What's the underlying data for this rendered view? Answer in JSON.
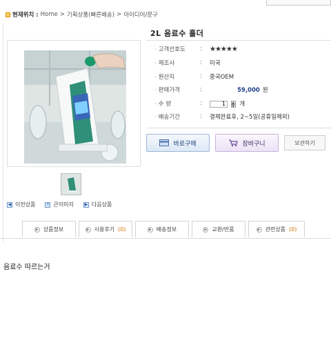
{
  "breadcrumb": {
    "here_label": "현재위치 :",
    "items": [
      "Home",
      "기획상품(빠른배송)",
      "아이디어/문구"
    ],
    "separator": ">"
  },
  "product": {
    "title": "2L 음료수 홀더",
    "info_rows": [
      {
        "label": "고객선호도",
        "value": "★★★★★"
      },
      {
        "label": "제조사",
        "value": "미국"
      },
      {
        "label": "원산지",
        "value": "중국OEM"
      },
      {
        "label": "판매가격",
        "value": "59,000",
        "unit": "원"
      },
      {
        "label": "수 량",
        "value": "1",
        "unit": "개"
      },
      {
        "label": "배송기간",
        "value": "결제완료후, 2~5일(공휴일제외)"
      }
    ]
  },
  "actions": {
    "buy_label": "바로구매",
    "cart_label": "장바구니",
    "keep_label": "보관하기"
  },
  "image_nav": {
    "prev_label": "이전상품",
    "zoom_label": "큰이미지",
    "next_label": "다음상품"
  },
  "tabs": [
    {
      "label": "상품정보",
      "count": ""
    },
    {
      "label": "사용후기",
      "count": "(0)"
    },
    {
      "label": "배송정보",
      "count": ""
    },
    {
      "label": "교환/반품",
      "count": ""
    },
    {
      "label": "관련상품",
      "count": "(0)"
    }
  ],
  "caption": "음료수 따르는거",
  "colors": {
    "price": "#1d3f8a",
    "shipping": "#c8102e",
    "stars": "#f2b400"
  }
}
